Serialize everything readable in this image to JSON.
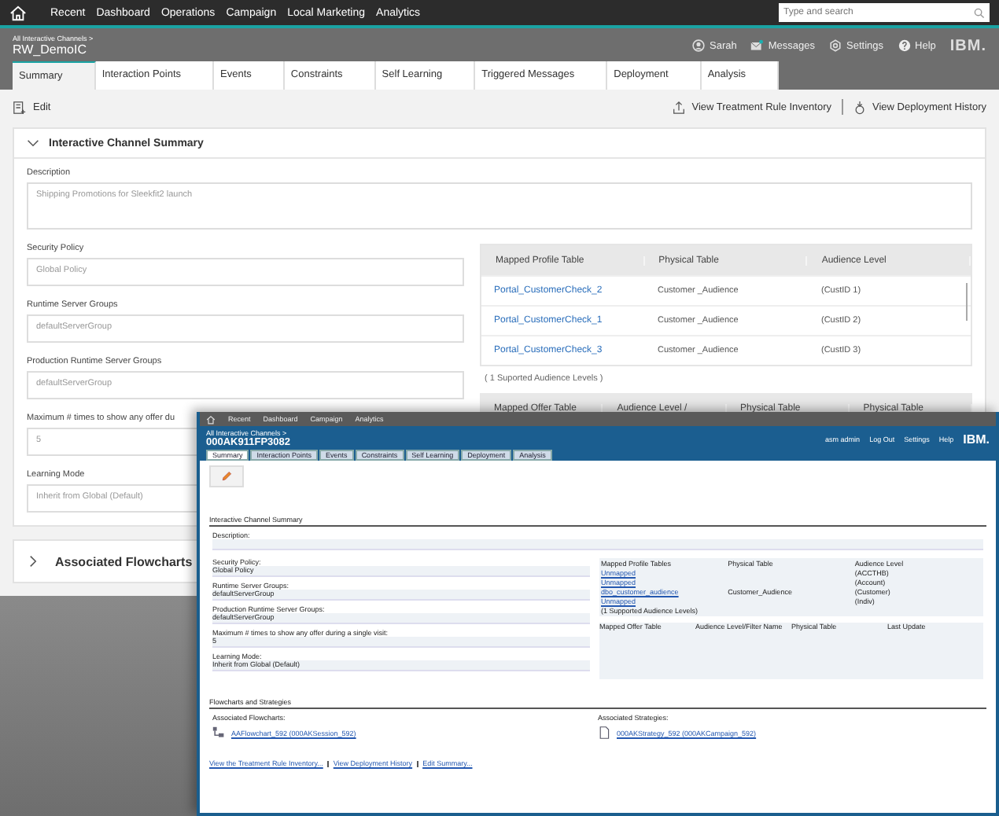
{
  "top_nav": {
    "items": [
      "Recent",
      "Dashboard",
      "Operations",
      "Campaign",
      "Local Marketing",
      "Analytics"
    ],
    "search": {
      "placeholder": "Type and search"
    }
  },
  "header": {
    "breadcrumb": "All Interactive Channels >",
    "title": "RW_DemoIC",
    "user": "Sarah",
    "messages": "Messages",
    "settings": "Settings",
    "help": "Help",
    "logo": "IBM."
  },
  "tabs": [
    {
      "label": "Summary",
      "selected": true
    },
    {
      "label": "Interaction Points",
      "selected": false
    },
    {
      "label": "Events",
      "selected": false
    },
    {
      "label": "Constraints",
      "selected": false
    },
    {
      "label": "Self Learning",
      "selected": false
    },
    {
      "label": "Triggered Messages",
      "selected": false
    },
    {
      "label": "Deployment",
      "selected": false
    },
    {
      "label": "Analysis",
      "selected": false
    }
  ],
  "toolbar": {
    "edit": "Edit",
    "treatment": "View Treatment Rule Inventory",
    "deployment": "View Deployment History"
  },
  "summary": {
    "title": "Interactive Channel Summary",
    "expanded": true,
    "fields": [
      {
        "label": "Description",
        "value": "Shipping Promotions for Sleekfit2 launch",
        "kind": "textarea"
      },
      {
        "label": "Security Policy",
        "value": "Global Policy",
        "kind": "input"
      },
      {
        "label": "Runtime Server Groups",
        "value": "defaultServerGroup",
        "kind": "input"
      },
      {
        "label": "Production Runtime Server Groups",
        "value": "defaultServerGroup",
        "kind": "input"
      },
      {
        "label": "Maximum # times to show any offer du",
        "value": "5",
        "kind": "input"
      },
      {
        "label": "Learning Mode",
        "value": "Inherit from Global (Default)",
        "kind": "input"
      }
    ],
    "profile_table": {
      "columns": [
        "Mapped Profile Table",
        "Physical Table",
        "Audience Level"
      ],
      "rows": [
        [
          "Portal_CustomerCheck_2",
          "Customer _Audience",
          "(CustID 1)"
        ],
        [
          "Portal_CustomerCheck_1",
          "Customer _Audience",
          "(CustID 2)"
        ],
        [
          "Portal_CustomerCheck_3",
          "Customer _Audience",
          "(CustID 3)"
        ]
      ],
      "note": "( 1 Suported Audience Levels )"
    },
    "offer_table": {
      "columns": [
        "Mapped Offer Table",
        "Audience Level /",
        "Physical Table",
        "Physical Table"
      ]
    }
  },
  "flowcharts": {
    "title": "Associated Flowcharts",
    "expanded": false
  },
  "overlay": {
    "nav": [
      "Recent",
      "Dashboard",
      "Campaign",
      "Analytics"
    ],
    "breadcrumb": "All Interactive Channels >",
    "title": "000AK911FP3082",
    "header_links": [
      "asm admin",
      "Log Out",
      "Settings",
      "Help"
    ],
    "logo": "IBM.",
    "tabs": [
      {
        "label": "Summary",
        "selected": true
      },
      {
        "label": "Interaction Points",
        "selected": false
      },
      {
        "label": "Events",
        "selected": false
      },
      {
        "label": "Constraints",
        "selected": false
      },
      {
        "label": "Self Learning",
        "selected": false
      },
      {
        "label": "Deployment",
        "selected": false
      },
      {
        "label": "Analysis",
        "selected": false
      }
    ],
    "section": "Interactive Channel Summary",
    "fields": [
      {
        "label": "Description:"
      },
      {
        "label": "Security Policy:",
        "value": "Global Policy"
      },
      {
        "label": "Runtime Server Groups:",
        "value": "defaultServerGroup"
      },
      {
        "label": "Production Runtime Server Groups:",
        "value": "defaultServerGroup"
      },
      {
        "label": "Maximum # times to show any offer during a single visit:",
        "value": "5"
      },
      {
        "label": "Learning Mode:",
        "value": "Inherit from Global (Default)"
      }
    ],
    "profile_table": {
      "columns": [
        "Mapped Profile Tables",
        "Physical Table",
        "Audience Level"
      ],
      "rows": [
        [
          "Unmapped",
          "",
          "(ACCTHB)"
        ],
        [
          "Unmapped",
          "",
          "(Account)"
        ],
        [
          "dbo_customer_audience",
          "Customer_Audience",
          "(Customer)"
        ],
        [
          "Unmapped",
          "",
          "(Indiv)"
        ]
      ],
      "note": "(1 Supported Audience Levels)"
    },
    "offer_table": {
      "columns": [
        "Mapped Offer Table",
        "Audience Level/Filter Name",
        "Physical Table",
        "Last Update"
      ]
    },
    "section2": "Flowcharts and Strategies",
    "flowcharts": {
      "label": "Associated Flowcharts:",
      "link": "AAFlowchart_592 (000AKSession_592)"
    },
    "strategies": {
      "label": "Associated Strategies:",
      "link": "000AKStrategy_592 (000AKCampaign_592)"
    },
    "footer_links": [
      "View the Treatment Rule Inventory...",
      "View Deployment History",
      "Edit Summary..."
    ]
  }
}
